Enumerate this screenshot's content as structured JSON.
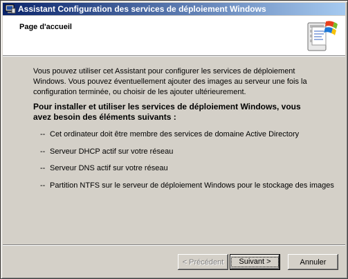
{
  "window": {
    "title": "Assistant Configuration des services de déploiement Windows"
  },
  "header": {
    "page_title": "Page d'accueil"
  },
  "content": {
    "intro": "Vous pouvez utiliser cet Assistant pour configurer les services de déploiement Windows. Vous pouvez éventuellement ajouter des images au serveur une fois la configuration terminée, ou choisir de les ajouter ultérieurement.",
    "lead": "Pour installer et utiliser les services de déploiement Windows, vous avez besoin des éléments suivants :",
    "requirements": [
      "Cet ordinateur doit être membre des services de domaine Active Directory",
      "Serveur DHCP actif sur votre réseau",
      "Serveur DNS actif sur votre réseau",
      "Partition NTFS sur le serveur de déploiement Windows pour le stockage des images"
    ],
    "dash": "--"
  },
  "buttons": {
    "previous": "< Précédent",
    "next": "Suivant >",
    "cancel": "Annuler"
  },
  "icons": {
    "title": "wizard-app-icon",
    "header": "server-deployment-icon"
  }
}
